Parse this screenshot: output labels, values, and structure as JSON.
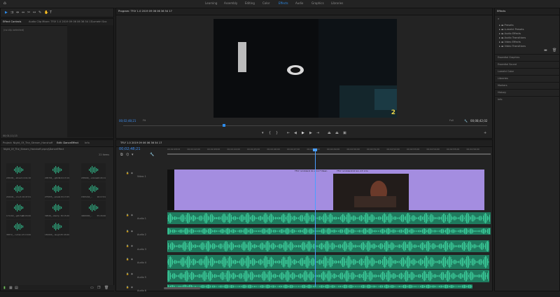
{
  "workspaces": [
    "Learning",
    "Assembly",
    "Editing",
    "Color",
    "Effects",
    "Audio",
    "Graphics",
    "Libraries"
  ],
  "active_workspace": "Effects",
  "source_panel": {
    "tabs": [
      "Effect Controls",
      "Audio Clip Mixer: TFLY 1.0 2019 09 06 06 36 54 17",
      "Lumetri Sco"
    ],
    "note": "(no clip selected)",
    "timecode": "00;01;11;13"
  },
  "program_monitor": {
    "title": "Program: TFLY 1.0 2019 09 06 06 36 54 17",
    "timecode": "00;02;48;21",
    "fit": "Fit",
    "quality": "Full",
    "duration": "00;08;42;02",
    "overlay_number": "2"
  },
  "project_panel": {
    "tabs": [
      "Project: Night_Of_The_Stream_Hanshoff",
      "Edit: DanceEffect",
      "Info"
    ],
    "path": "Night_Of_The_Stream_Hanshoff.prproj\\DanceEffect",
    "item_count": "22 items",
    "items": [
      {
        "name": "205291_..stream",
        "duration": "4:41;16"
      },
      {
        "name": "205791_..glitch",
        "duration": "1:41;13:19"
      },
      {
        "name": "205990_..unkow",
        "duration": "16:43;11"
      },
      {
        "name": "244441_..crush",
        "duration": "16:47;01"
      },
      {
        "name": "275055_..pixel..",
        "duration": "1:15;17;05"
      },
      {
        "name": "1505242_..",
        "duration": "16:17;01"
      },
      {
        "name": "171102_..glitches",
        "duration": "15:03;00"
      },
      {
        "name": "39526_..stamp",
        "duration": "30:15;00"
      },
      {
        "name": "4000000_..",
        "duration": "55:43;00"
      },
      {
        "name": "38372_..curtain..",
        "duration": "15:13;00"
      },
      {
        "name": "181000_..laugh..",
        "duration": "55:43;00"
      }
    ]
  },
  "timeline": {
    "tab": "TFLY 1.0 2019 09 06 06 36 54 17",
    "timecode": "00;02;48;21",
    "ruler": [
      "00;02;48;02",
      "00;02;42;00",
      "00;02;48;00",
      "00;02;44;00",
      "00;02;45;00",
      "00;02;46;00",
      "00;02;47;00",
      "00;02;48;00",
      "00;02;49;00",
      "00;02;50;00",
      "00;02;51;00",
      "00;02;52;00",
      "00;02;53;00",
      "00;02;54;00",
      "00;02;55;00",
      "00;02;56;00"
    ],
    "tracks": [
      "Video 1",
      "Audio 1",
      "Audio 2",
      "Audio 3",
      "Audio 4",
      "Audio 5",
      "Audio 6"
    ],
    "clip_labels": [
      "TFLY ncinblend 4x 2 11 F Mean",
      "TFLY ncinblend14 lan..13 1.hs"
    ]
  },
  "effects_panel": {
    "title": "Effects",
    "tree": [
      "Presets",
      "Lumetri Presets",
      "Audio Effects",
      "Audio Transitions",
      "Video Effects",
      "Video Transitions"
    ],
    "sections": [
      "Essential Graphics",
      "Essential Sound",
      "Lumetri Color",
      "Libraries",
      "Markers",
      "History",
      "Info"
    ]
  },
  "colors": {
    "accent": "#2d8ceb",
    "video_clip": "#a48de0",
    "audio_clip": "#2da27a",
    "audio_clip_dark": "#1e6d56",
    "timecode": "#3e8ef0",
    "playhead": "#4a9fff"
  }
}
